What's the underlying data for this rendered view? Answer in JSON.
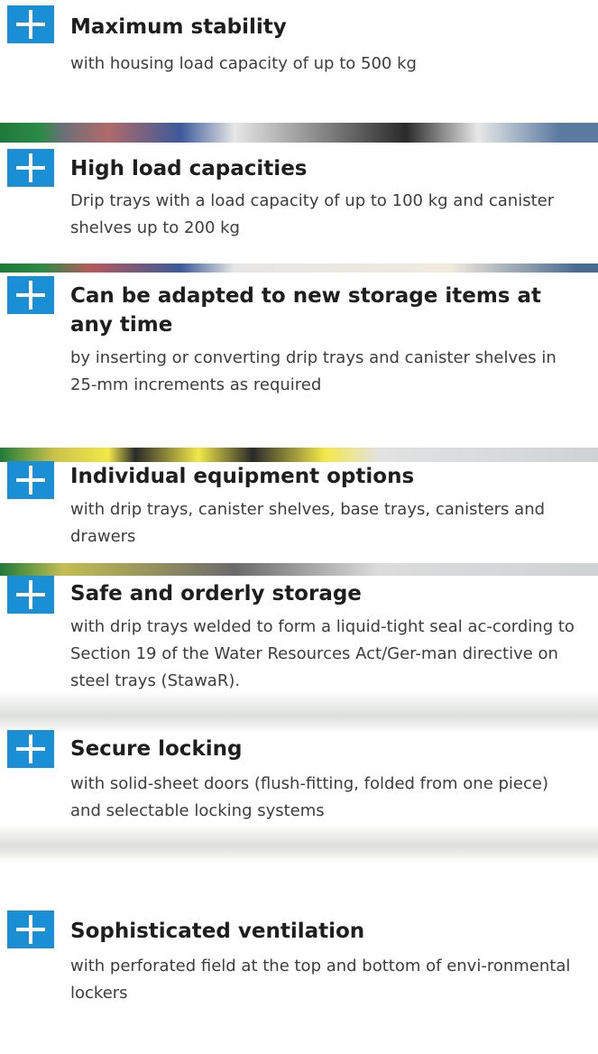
{
  "colors": {
    "accent": "#1a8fd6",
    "panel": "#ffffff",
    "title": "#1e1e1e",
    "text": "#3d3d3d"
  },
  "features": [
    {
      "icon": "plus-icon",
      "title": "Maximum stability",
      "description": "with housing load capacity of up to 500 kg"
    },
    {
      "icon": "plus-icon",
      "title": "High load capacities",
      "description": "Drip trays with a load capacity of up to 100 kg and canister shelves up to 200 kg"
    },
    {
      "icon": "plus-icon",
      "title": "Can be adapted to new storage items at any time",
      "description": "by inserting or converting drip trays and canister shelves in 25-mm increments as required"
    },
    {
      "icon": "plus-icon",
      "title": "Individual equipment options",
      "description": "with drip trays, canister shelves, base trays, canisters and drawers"
    },
    {
      "icon": "plus-icon",
      "title": "Safe and orderly storage",
      "description": "with drip trays welded to form a liquid-tight seal ac-cording to Section 19 of the Water Resources Act/Ger-man directive on steel trays (StawaR)."
    },
    {
      "icon": "plus-icon",
      "title": "Secure locking",
      "description": "with solid-sheet doors (flush-fitting, folded from one piece) and selectable locking systems"
    },
    {
      "icon": "plus-icon",
      "title": "Sophisticated ventilation",
      "description": "with perforated field at the top and bottom of envi-ronmental lockers"
    }
  ]
}
